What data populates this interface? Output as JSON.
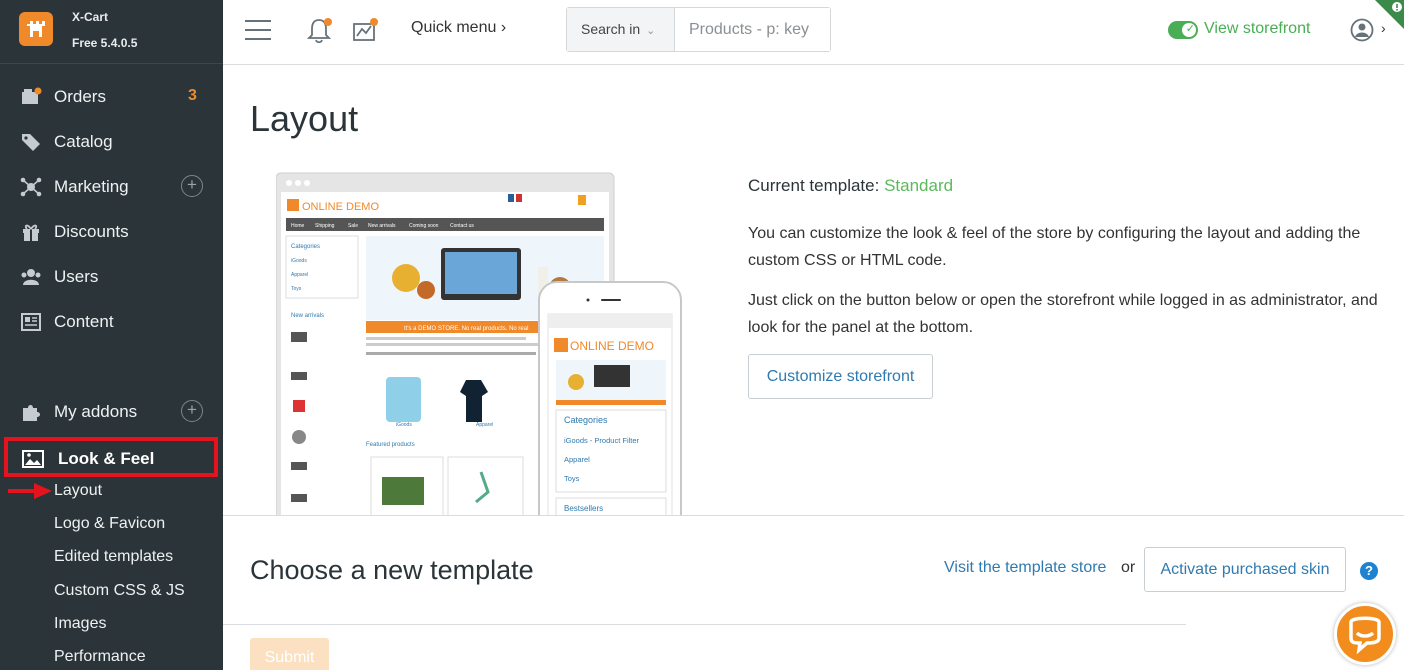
{
  "brand": {
    "name": "X-Cart",
    "version": "Free 5.4.0.5"
  },
  "sidebar": {
    "items": [
      {
        "label": "Orders",
        "badge": "3",
        "icon": "orders-icon"
      },
      {
        "label": "Catalog",
        "icon": "tag-icon"
      },
      {
        "label": "Marketing",
        "icon": "marketing-icon"
      },
      {
        "label": "Discounts",
        "icon": "gift-icon"
      },
      {
        "label": "Users",
        "icon": "users-icon"
      },
      {
        "label": "Content",
        "icon": "content-icon"
      },
      {
        "label": "My addons",
        "icon": "puzzle-icon"
      },
      {
        "label": "Look & Feel",
        "icon": "image-icon"
      }
    ],
    "subitems": [
      "Layout",
      "Logo & Favicon",
      "Edited templates",
      "Custom CSS & JS",
      "Images",
      "Performance"
    ]
  },
  "header": {
    "quick_menu": "Quick menu",
    "quick_menu_chevron": "›",
    "search_in": "Search in",
    "search_placeholder": "Products - p: key",
    "view_storefront": "View storefront"
  },
  "main": {
    "title": "Layout",
    "current_template_label": "Current template:",
    "current_template_value": "Standard",
    "desc1": "You can customize the look & feel of the store by configuring the layout and adding the custom CSS or HTML code.",
    "desc2_line1": "Just click on the button below or open the storefront while logged in as administrator, and",
    "desc2_line2": "look for the panel at the bottom.",
    "customize_button": "Customize storefront",
    "choose_title": "Choose a new template",
    "visit_link": "Visit the template store",
    "or": "or",
    "activate_button": "Activate purchased skin",
    "submit_button": "Submit",
    "help": "?"
  },
  "preview": {
    "desktop_logo": "ONLINE DEMO",
    "desktop_nav": [
      "Home",
      "Shipping",
      "Sale",
      "New arrivals",
      "Coming soon",
      "Contact us"
    ],
    "desktop_categories_title": "Categories",
    "desktop_categories": [
      "iGoods",
      "Apparel",
      "Toys"
    ],
    "desktop_new_arrivals": "New arrivals",
    "desktop_featured": "Featured products",
    "mobile_logo": "ONLINE DEMO",
    "mobile_categories_title": "Categories",
    "mobile_categories": [
      "iGoods - Product Filter",
      "Apparel",
      "Toys"
    ],
    "mobile_bestsellers": "Bestsellers",
    "banner_text": "It's a DEMO STORE. No real products. No real",
    "product1": "iGoods",
    "product2": "Apparel"
  },
  "colors": {
    "sidebar_bg": "#2b3539",
    "accent": "#f0892a",
    "green": "#4aae56",
    "link": "#2f7ab0",
    "highlight": "#e5131d"
  }
}
